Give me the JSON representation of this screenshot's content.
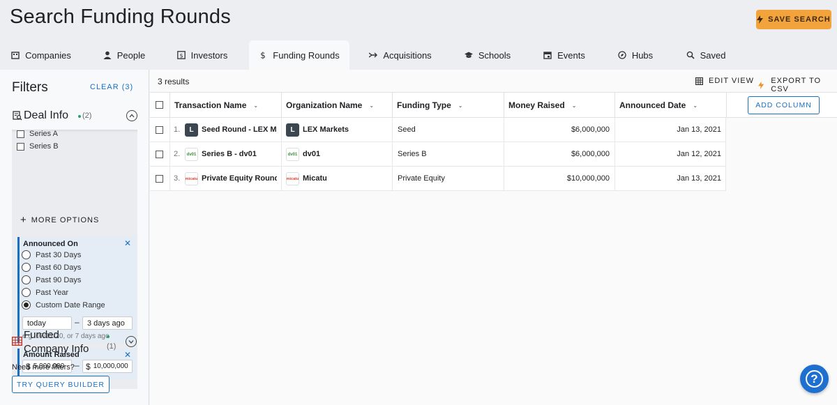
{
  "header": {
    "title": "Search Funding Rounds",
    "save_search_label": "SAVE SEARCH"
  },
  "tabs": [
    {
      "label": "Companies",
      "icon": "building-icon"
    },
    {
      "label": "People",
      "icon": "person-icon"
    },
    {
      "label": "Investors",
      "icon": "dollar-box-icon"
    },
    {
      "label": "Funding Rounds",
      "icon": "dollar-icon",
      "active": true
    },
    {
      "label": "Acquisitions",
      "icon": "merge-arrow-icon"
    },
    {
      "label": "Schools",
      "icon": "graduation-cap-icon"
    },
    {
      "label": "Events",
      "icon": "calendar-icon"
    },
    {
      "label": "Hubs",
      "icon": "compass-icon"
    },
    {
      "label": "Saved",
      "icon": "saved-search-icon"
    }
  ],
  "sidebar": {
    "title": "Filters",
    "clear_label": "CLEAR (3)",
    "deal_info": {
      "label": "Deal Info",
      "count": "(2)",
      "checkboxes": [
        "Series A",
        "Series B"
      ],
      "more_options": "MORE OPTIONS",
      "announced_on": {
        "title": "Announced On",
        "options": [
          "Past 30 Days",
          "Past 60 Days",
          "Past 90 Days",
          "Past Year",
          "Custom Date Range"
        ],
        "selected": "Custom Date Range",
        "from": "today",
        "to": "3 days ago",
        "hint": "e.g. 07/12/20, or 7 days ago"
      },
      "amount_raised": {
        "title": "Amount Raised",
        "currency": "$",
        "min": "5,000,000",
        "max": "10,000,000"
      }
    },
    "funded_company": {
      "label": "Funded Company Info",
      "count": "(1)"
    },
    "need_more": "Need more filters?",
    "query_builder": "TRY QUERY BUILDER"
  },
  "main": {
    "results": "3 results",
    "edit_view": "EDIT VIEW",
    "export": "EXPORT TO CSV",
    "add_column": "ADD COLUMN",
    "columns": [
      "Transaction Name",
      "Organization Name",
      "Funding Type",
      "Money Raised",
      "Announced Date"
    ],
    "rows": [
      {
        "num": "1.",
        "transaction": "Seed Round - LEX M...",
        "organization": "LEX Markets",
        "funding_type": "Seed",
        "money": "$6,000,000",
        "date": "Jan 13, 2021",
        "logo_text": "L"
      },
      {
        "num": "2.",
        "transaction": "Series B - dv01",
        "organization": "dv01",
        "funding_type": "Series B",
        "money": "$6,000,000",
        "date": "Jan 12, 2021",
        "logo_text": "dv01"
      },
      {
        "num": "3.",
        "transaction": "Private Equity Round...",
        "organization": "Micatu",
        "funding_type": "Private Equity",
        "money": "$10,000,000",
        "date": "Jan 13, 2021",
        "logo_text": "micatu"
      }
    ]
  },
  "colors": {
    "accent": "#1a6fc2",
    "save_button": "#f3a33c",
    "status_dot": "#2e9f6a"
  }
}
